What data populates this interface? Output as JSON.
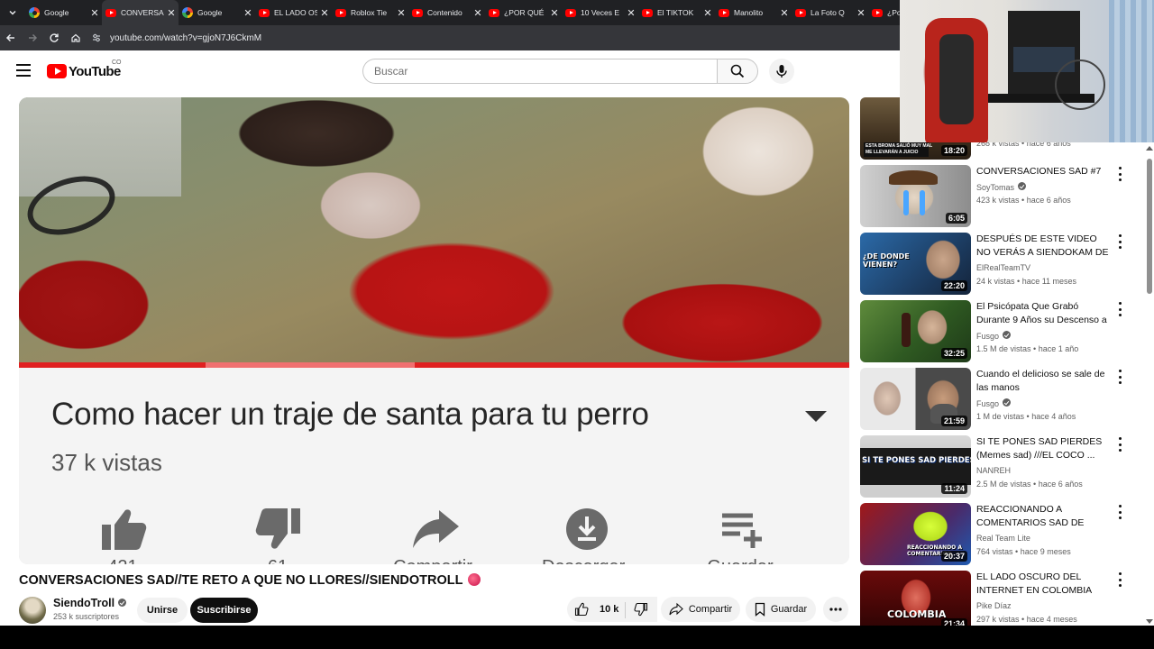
{
  "browser": {
    "tabs": [
      {
        "title": "Google",
        "favicon": "google-icon",
        "active": false
      },
      {
        "title": "CONVERSACIONES",
        "favicon": "youtube-icon",
        "active": true
      },
      {
        "title": "Google",
        "favicon": "google-icon",
        "active": false
      },
      {
        "title": "EL LADO OSCURO",
        "favicon": "youtube-icon",
        "active": false
      },
      {
        "title": "Roblox Tie",
        "favicon": "youtube-icon",
        "active": false
      },
      {
        "title": "Contenido",
        "favicon": "youtube-icon",
        "active": false
      },
      {
        "title": "¿POR QUÉ",
        "favicon": "youtube-icon",
        "active": false
      },
      {
        "title": "10 Veces E",
        "favicon": "youtube-icon",
        "active": false
      },
      {
        "title": "El TIKTOK",
        "favicon": "youtube-icon",
        "active": false
      },
      {
        "title": "Manolito",
        "favicon": "youtube-icon",
        "active": false
      },
      {
        "title": "La Foto Q",
        "favicon": "youtube-icon",
        "active": false
      },
      {
        "title": "¿Po",
        "favicon": "youtube-icon",
        "active": false
      }
    ],
    "url": "youtube.com/watch?v=gjoN7J6CkmM"
  },
  "youtube": {
    "logo_text": "YouTube",
    "country_code": "CO",
    "search_placeholder": "Buscar"
  },
  "player": {
    "overlay_title": "Como hacer un traje de santa para tu perro",
    "overlay_views": "37 k vistas",
    "overlay_action_labels": [
      "421",
      "61",
      "Compartir",
      "Descargar",
      "Guardar"
    ]
  },
  "video": {
    "title": "CONVERSACIONES SAD//TE RETO A QUE NO LLORES//SIENDOTROLL",
    "channel": "SiendoTroll",
    "subscribers": "253 k suscriptores",
    "join_label": "Unirse",
    "subscribe_label": "Suscribirse",
    "likes": "10 k",
    "share_label": "Compartir",
    "save_label": "Guardar"
  },
  "recommendations": [
    {
      "title": "",
      "channel": "",
      "verified": false,
      "views": "268 k vistas",
      "age": "hace 6 años",
      "duration": "18:20",
      "thumb_text": "ESTA BROMA SALIÓ MUY MAL\nME LLEVARÁN A JUICIO"
    },
    {
      "title": "CONVERSACIONES  SAD #7",
      "channel": "SoyTomas",
      "verified": true,
      "views": "423 k vistas",
      "age": "hace 6 años",
      "duration": "6:05",
      "thumb_text": ""
    },
    {
      "title": "DESPUÉS DE ESTE VIDEO NO VERÁS A SIENDOKAM DE LA ...",
      "channel": "ElRealTeamTV",
      "verified": false,
      "views": "24 k vistas",
      "age": "hace 11 meses",
      "duration": "22:20",
      "thumb_text": "¿DE DONDE\nVIENEN?"
    },
    {
      "title": "El Psicópata Que Grabó Durante 9 Años su Descenso a la Locura",
      "channel": "Fusgo",
      "verified": true,
      "views": "1.5 M de vistas",
      "age": "hace 1 año",
      "duration": "32:25",
      "thumb_text": ""
    },
    {
      "title": "Cuando el delicioso se sale de las manos",
      "channel": "Fusgo",
      "verified": true,
      "views": "1 M de vistas",
      "age": "hace 4 años",
      "duration": "21:59",
      "thumb_text": ""
    },
    {
      "title": "SI TE PONES SAD PIERDES (Memes sad) ///EL COCO ...",
      "channel": "NANREH",
      "verified": false,
      "views": "2.5 M de vistas",
      "age": "hace 6 años",
      "duration": "11:24",
      "thumb_text": "SI TE PONES SAD PIERDES"
    },
    {
      "title": "REACCIONANDO A COMENTARIOS SAD DE SIEND...",
      "channel": "Real Team Lite",
      "verified": false,
      "views": "764 vistas",
      "age": "hace 9 meses",
      "duration": "20:37",
      "thumb_text": "REACCIONANDO A\nCOMENTARIOS"
    },
    {
      "title": "EL LADO OSCURO DEL INTERNET EN COLOMBIA",
      "channel": "Pike Díaz",
      "verified": false,
      "views": "297 k vistas",
      "age": "hace 4 meses",
      "duration": "21:34",
      "thumb_text": "COLOMBIA"
    }
  ],
  "colors": {
    "youtube_red": "#ff0000",
    "chrome_dark": "#202124",
    "subscribe_bg": "#0f0f0f"
  }
}
